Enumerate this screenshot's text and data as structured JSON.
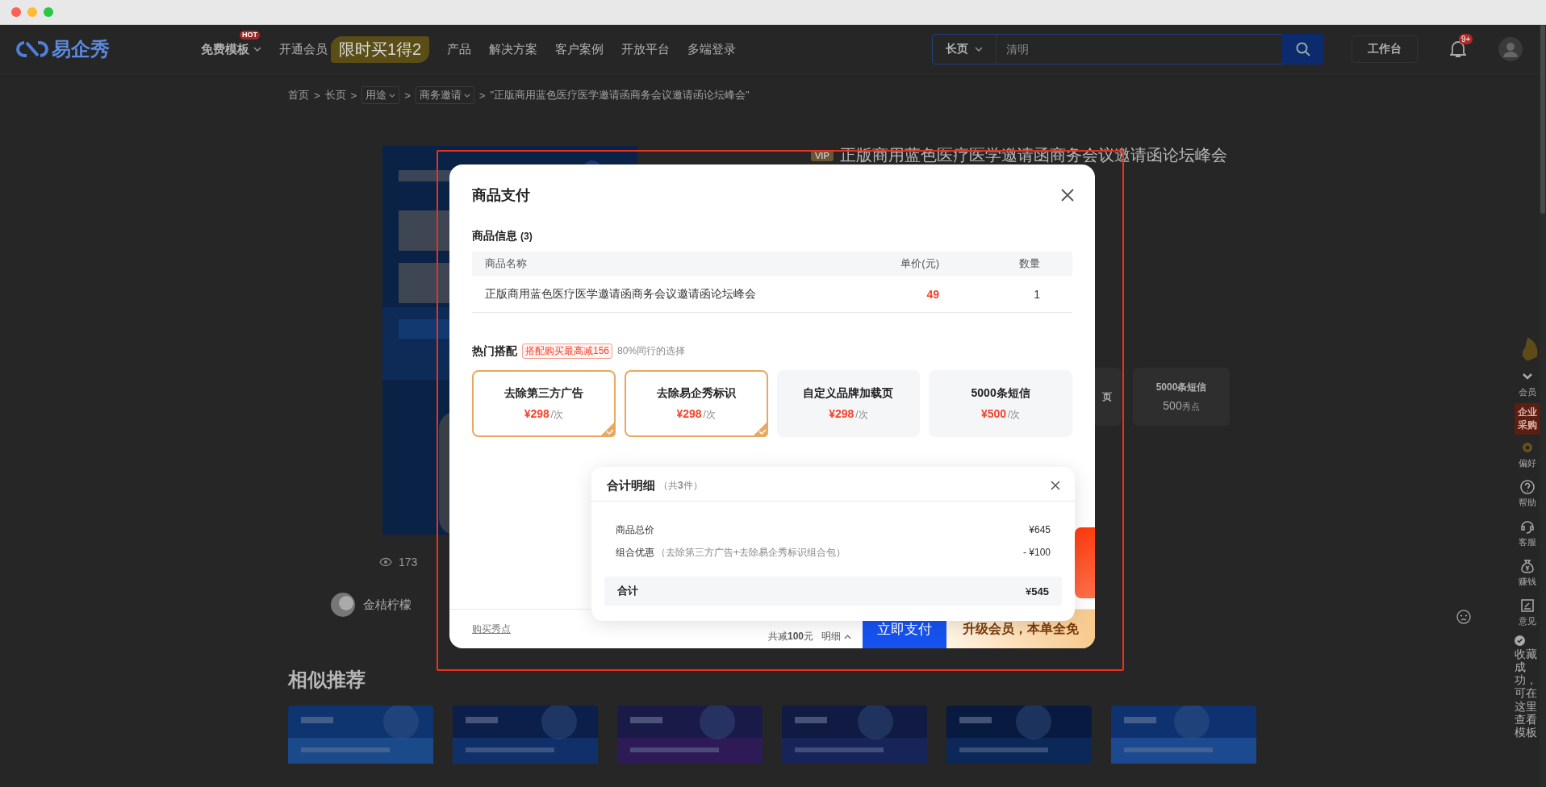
{
  "nav": {
    "logo": "易企秀",
    "items": [
      {
        "label": "免费模板",
        "kind": "dropdown",
        "badge": "HOT"
      },
      {
        "label": "开通会员",
        "kind": "link"
      },
      {
        "label": "限时买1得2",
        "kind": "promo"
      },
      {
        "label": "产品",
        "kind": "link"
      },
      {
        "label": "解决方案",
        "kind": "link"
      },
      {
        "label": "客户案例",
        "kind": "link"
      },
      {
        "label": "开放平台",
        "kind": "link"
      },
      {
        "label": "多端登录",
        "kind": "link"
      }
    ],
    "search": {
      "scope": "长页",
      "placeholder": "清明"
    },
    "workbench": "工作台",
    "notifications": "9+"
  },
  "breadcrumb": [
    {
      "label": "首页",
      "kind": "link"
    },
    {
      "label": "长页",
      "kind": "link",
      "sep": ">"
    },
    {
      "label": "用途",
      "kind": "dropdown",
      "sep": ">"
    },
    {
      "label": "商务邀请",
      "kind": "dropdown",
      "sep": ">"
    },
    {
      "label": "\"正版商用蓝色医疗医学邀请函商务会议邀请函论坛峰会\"",
      "kind": "current",
      "sep": ">"
    }
  ],
  "product": {
    "vip": "VIP",
    "title": "正版商用蓝色医疗医学邀请函商务会议邀请函论坛峰会",
    "views": "173",
    "author": "金桔柠檬",
    "addons": [
      {
        "title": "页"
      },
      {
        "title": "5000条短信",
        "price": "500",
        "unit": "秀点"
      }
    ]
  },
  "similar": {
    "title": "相似推荐"
  },
  "sidebar": {
    "items": [
      {
        "label": "会员",
        "kind": "icon"
      },
      {
        "label": "企业采购",
        "kind": "highlight"
      },
      {
        "label": "偏好",
        "kind": "icon"
      },
      {
        "label": "帮助",
        "kind": "icon"
      },
      {
        "label": "客服",
        "kind": "icon"
      },
      {
        "label": "赚钱",
        "kind": "icon"
      },
      {
        "label": "意见",
        "kind": "icon"
      }
    ],
    "toast": "收藏成功，可在这里查看模板"
  },
  "dialog": {
    "title": "商品支付",
    "info": {
      "title": "商品信息",
      "count": "(3)",
      "columns": [
        "商品名称",
        "单价(元)",
        "数量"
      ],
      "rows": [
        {
          "name": "正版商用蓝色医疗医学邀请函商务会议邀请函论坛峰会",
          "price": "49",
          "quantity": "1"
        }
      ]
    },
    "bundles": {
      "title": "**热门**搭配",
      "tag": "搭配购买最高减156",
      "note": "80%同行的选择",
      "items": [
        {
          "name": "去除第三方广告",
          "price": "¥298",
          "unit": "/次",
          "selected": true
        },
        {
          "name": "去除易企秀标识",
          "price": "¥298",
          "unit": "/次",
          "selected": true
        },
        {
          "name": "自定义品牌加载页",
          "price": "¥298",
          "unit": "/次",
          "selected": false
        },
        {
          "name": "5000条短信",
          "price": "¥500",
          "unit": "/次",
          "selected": false
        }
      ]
    },
    "footer": {
      "link": "购买秀点",
      "saving": "共减**100**元",
      "details": "明细",
      "pay": "立即支付",
      "upgrade": "升级会员，本单全免"
    },
    "summary": {
      "title": "合计明细",
      "count": "（共**3**件）",
      "rows": [
        {
          "label": "商品总价",
          "price": "¥645"
        },
        {
          "label": "组合优惠",
          "note": "（去除第三方广告+去除易企秀标识组合包）",
          "price": "- ¥100"
        }
      ],
      "total_label": "合计",
      "total": "¥**545**"
    }
  }
}
